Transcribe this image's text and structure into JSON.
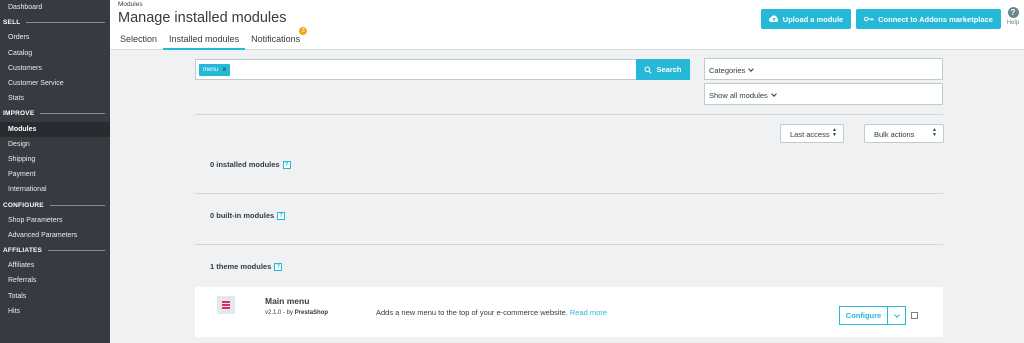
{
  "sidebar": {
    "dashboard": "Dashboard",
    "sections": {
      "sell": "SELL",
      "improve": "IMPROVE",
      "configure": "CONFIGURE",
      "affiliates": "AFFILIATES"
    },
    "sell_items": [
      "Orders",
      "Catalog",
      "Customers",
      "Customer Service",
      "Stats"
    ],
    "improve_items": [
      "Modules",
      "Design",
      "Shipping",
      "Payment",
      "International"
    ],
    "configure_items": [
      "Shop Parameters",
      "Advanced Parameters"
    ],
    "affiliate_items": [
      "Affiliates",
      "Referrals",
      "Totals",
      "Hits"
    ]
  },
  "header": {
    "breadcrumb": "Modules",
    "title": "Manage installed modules",
    "tabs": [
      {
        "label": "Selection"
      },
      {
        "label": "Installed modules"
      },
      {
        "label": "Notifications",
        "badge": "3"
      }
    ],
    "upload_label": "Upload a module",
    "addons_label": "Connect to Addons marketplace",
    "help_label": "Help"
  },
  "search": {
    "chip": "menu",
    "button_label": "Search",
    "categories_label": "Categories",
    "filter_label": "Show all modules"
  },
  "sort": {
    "order_label": "Last access",
    "bulk_label": "Bulk actions"
  },
  "groups": {
    "installed": "0 installed modules",
    "builtin": "0 built-in modules",
    "theme": "1 theme modules"
  },
  "module": {
    "name": "Main menu",
    "version": "v2.1.0 - by",
    "author": "PrestaShop",
    "description": "Adds a new menu to the top of your e-commerce website.",
    "readmore": "Read more",
    "configure_label": "Configure"
  },
  "colors": {
    "accent": "#25b9d7",
    "sidebar_bg": "#363a41",
    "badge": "#f0a90d",
    "module_logo": "#d92e72"
  },
  "icons": {
    "upload": "cloud-upload-icon",
    "addons": "key-icon",
    "search": "magnifier-icon",
    "help": "question-circle-icon"
  }
}
